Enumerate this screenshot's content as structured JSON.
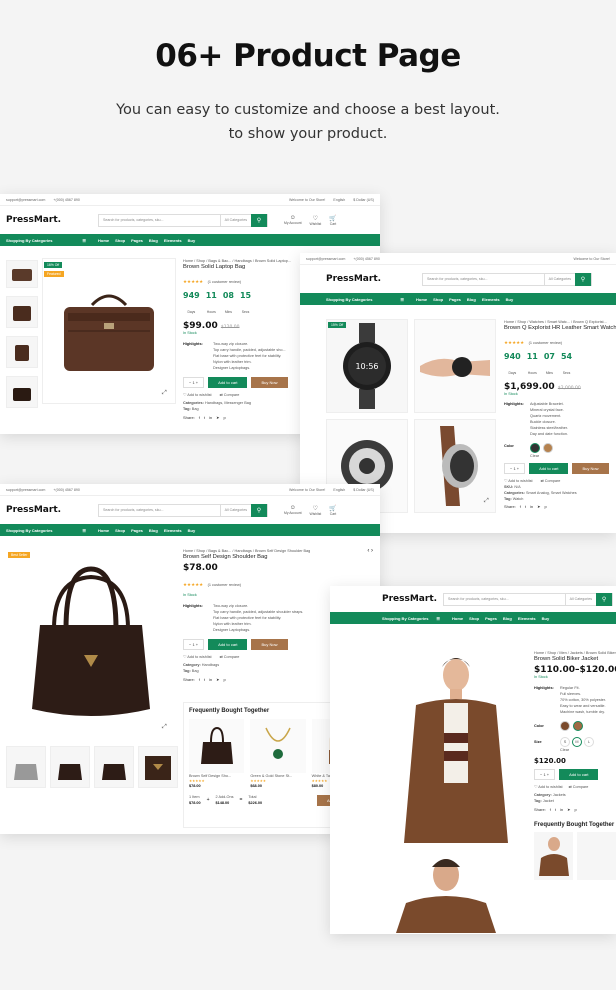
{
  "hero": {
    "title": "06+ Product Page",
    "subtitle_line1": "You can easy to customize and choose a best layout.",
    "subtitle_line2": "to show your product."
  },
  "site": {
    "email": "support@pressmart.com",
    "phone": "+(000) 4567 890",
    "welcome": "Welcome to Our Store!",
    "lang": "English",
    "currency": "$ Dollar (US)",
    "logo": "PressMart.",
    "search_placeholder": "Search for products, categories, sku...",
    "search_category": "All Categories",
    "account": "My Account",
    "wishlist": "Wishlist",
    "cart": "Cart",
    "categories": "Shopping By Categories",
    "nav": [
      "Home",
      "Shop",
      "Pages",
      "Blog",
      "Elements",
      "Buy"
    ]
  },
  "shot1": {
    "breadcrumb": "Home / Shop / Bags & Bac... / Handbags / Brown Solid Laptop...",
    "title": "Brown Solid Laptop Bag",
    "reviews": "(1 customer review)",
    "countdown": [
      {
        "v": "949",
        "l": "Days"
      },
      {
        "v": "11",
        "l": "Hours"
      },
      {
        "v": "08",
        "l": "Mins"
      },
      {
        "v": "15",
        "l": "Secs"
      }
    ],
    "price": "$99.00",
    "old_price": "$120.00",
    "stock": "In Stock",
    "highlights_label": "Highlights:",
    "highlights": [
      "Two-way zip closure.",
      "Top carry handle, padded, adjustable sho...",
      "Flat base with protective feet for stability.",
      "Nylon with leather trim.",
      "Designer Laptopbags."
    ],
    "qty": "1",
    "add_to_cart": "Add to cart",
    "buy_now": "Buy Now",
    "wishlist": "Add to wishlist",
    "compare": "Compare",
    "categories_label": "Categories:",
    "categories": "Handbags, Messenger Bag",
    "tag_label": "Tag:",
    "tag": "Bag",
    "share": "Share:",
    "sale_badge": "16% Off",
    "featured_badge": "Featured"
  },
  "shot2": {
    "breadcrumb": "Home / Shop / Watches / Smart Watc... / Brown Q Explorist...",
    "title": "Brown Q Explorist HR Leather Smart Watch",
    "reviews": "(1 customer review)",
    "countdown": [
      {
        "v": "940",
        "l": "Days"
      },
      {
        "v": "11",
        "l": "Hours"
      },
      {
        "v": "07",
        "l": "Mins"
      },
      {
        "v": "54",
        "l": "Secs"
      }
    ],
    "price": "$1,699.00",
    "old_price": "$2,000.00",
    "stock": "In Stock",
    "highlights_label": "Highlights:",
    "highlights": [
      "Adjustable Bracelet.",
      "Mineral crystal face.",
      "Quartz movement.",
      "Buckle closure.",
      "Stainless steel/leather.",
      "Day and date function."
    ],
    "color_label": "Color",
    "clear": "Clear",
    "qty": "1",
    "add_to_cart": "Add to cart",
    "buy_now": "Buy Now",
    "wishlist": "Add to wishlist",
    "compare": "Compare",
    "sku_label": "SKU:",
    "sku": "N/A",
    "categories_label": "Categories:",
    "categories": "Smart Analog, Smart Watches",
    "tag_label": "Tag:",
    "tag": "Watch",
    "share": "Share:",
    "sale_badge": "15% Off",
    "watch_time": "10:56"
  },
  "shot3": {
    "breadcrumb": "Home / Shop / Bags & Bac... / Handbags / Brown Self Design Shoulder Bag",
    "title": "Brown Self Design Shoulder Bag",
    "price": "$78.00",
    "reviews": "(1 customer review)",
    "stock": "In Stock",
    "highlights_label": "Highlights:",
    "highlights": [
      "Two-way zip closure.",
      "Top carry handle, padded, adjustable shoulder straps.",
      "Flat base with protective feet for stability.",
      "Nylon with leather trim.",
      "Designer Laptopbags."
    ],
    "qty": "1",
    "add_to_cart": "Add to cart",
    "buy_now": "Buy Now",
    "wishlist": "Add to wishlist",
    "compare": "Compare",
    "category_label": "Category:",
    "category": "Handbags",
    "tag_label": "Tag:",
    "tag": "Bag",
    "share": "Share:",
    "badge": "Best Seller",
    "fbt_title": "Frequently Bought Together",
    "fbt_items": [
      {
        "name": "Brown Self Design Sho...",
        "price": "$78.00"
      },
      {
        "name": "Green & Gold Stone St...",
        "price": "$68.00"
      },
      {
        "name": "White & Tan Brown Cal...",
        "price": "$80.00"
      }
    ],
    "fbt_totals": [
      {
        "label": "1 Item",
        "value": "$78.00"
      },
      {
        "label": "2 Add-Ons",
        "value": "$148.00"
      },
      {
        "label": "Total",
        "value": "$226.00"
      }
    ],
    "fbt_button": "Add items to cart"
  },
  "shot4": {
    "breadcrumb": "Home / Shop / Men / Jackets / Brown Solid Biker Jacket",
    "title": "Brown Solid Biker Jacket",
    "price": "$110.00–$120.00",
    "stock": "In Stock",
    "highlights_label": "Highlights:",
    "highlights": [
      "Regular Fit.",
      "Full sleeves.",
      "70% cotton, 30% polyester.",
      "Easy to wear and versatile.",
      "Machine wash, tumble dry."
    ],
    "color_label": "Color",
    "size_label": "Size",
    "sizes": [
      "S",
      "M",
      "L"
    ],
    "clear": "Clear",
    "price2": "$120.00",
    "qty": "1",
    "add_to_cart": "Add to cart",
    "wishlist": "Add to wishlist",
    "compare": "Compare",
    "category_label": "Category:",
    "category": "Jackets",
    "tag_label": "Tag:",
    "tag": "Jacket",
    "share": "Share:",
    "fbt_title": "Frequently Bought Together"
  },
  "colors": {
    "accent": "#138a5a",
    "buy": "#a7744a",
    "star": "#f5a623"
  }
}
